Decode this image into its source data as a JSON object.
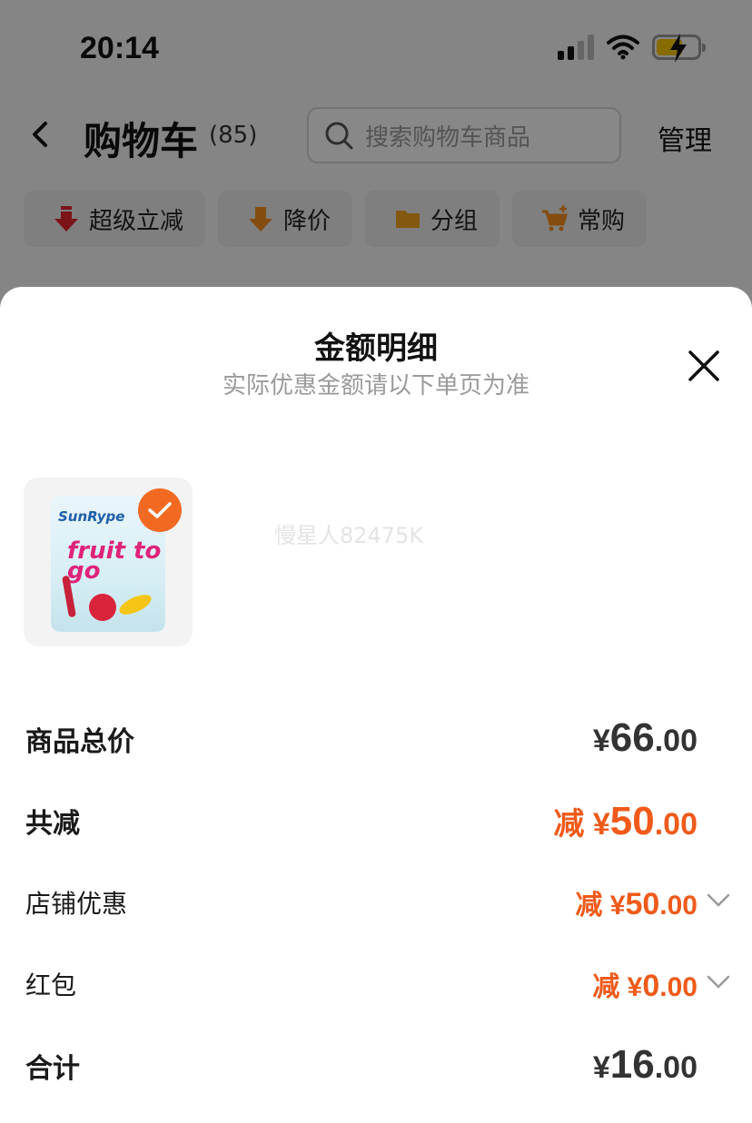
{
  "status_bar": {
    "time": "20:14"
  },
  "nav": {
    "title": "购物车",
    "count": "(85)",
    "search_placeholder": "搜索购物车商品",
    "manage": "管理"
  },
  "chips": [
    {
      "label": "超级立减",
      "icon": "red-down-arrow-icon",
      "color": "#e0232d"
    },
    {
      "label": "降价",
      "icon": "orange-down-arrow-icon",
      "color": "#f08a1a"
    },
    {
      "label": "分组",
      "icon": "folder-icon",
      "color": "#f0a01a"
    },
    {
      "label": "常购",
      "icon": "cart-plus-icon",
      "color": "#f08a1a"
    }
  ],
  "sheet": {
    "title": "金额明细",
    "subtitle": "实际优惠金额请以下单页为准",
    "watermark": "慢星人82475K",
    "product": {
      "brand": "SunRype",
      "name": "fruit to go",
      "selected": true
    }
  },
  "summary": {
    "goods_total": {
      "label": "商品总价",
      "currency": "¥",
      "int": "66",
      "dec": ".00"
    },
    "total_discount": {
      "label": "共减",
      "prefix": "减 ",
      "currency": "¥",
      "int": "50",
      "dec": ".00"
    },
    "shop_discount": {
      "label": "店铺优惠",
      "prefix": "减 ",
      "currency": "¥",
      "int": "50",
      "dec": ".00"
    },
    "red_packet": {
      "label": "红包",
      "prefix": "减 ",
      "currency": "¥",
      "int": "0",
      "dec": ".00"
    },
    "total": {
      "label": "合计",
      "currency": "¥",
      "int": "16",
      "dec": ".00"
    }
  },
  "colors": {
    "accent": "#f05a1a",
    "check": "#f26a22"
  }
}
